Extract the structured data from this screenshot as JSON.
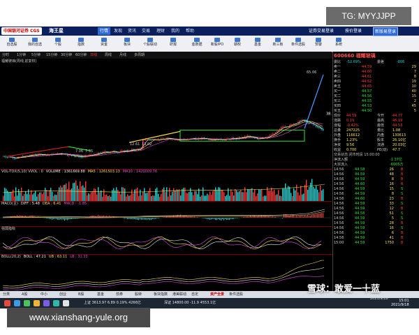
{
  "window": {
    "logo_text": "中国银河证券 CGS",
    "brand_name": "海王星"
  },
  "menu": [
    {
      "label": "行情",
      "active": true
    },
    {
      "label": "发现"
    },
    {
      "label": "资讯"
    },
    {
      "label": "交易"
    },
    {
      "label": "理财"
    },
    {
      "label": "我的"
    },
    {
      "label": "帮助"
    }
  ],
  "top_buttons": [
    "证券交易登录",
    "按价登录",
    "新版易登录"
  ],
  "toolbar": [
    {
      "label": "自选股",
      "icon": "star-icon"
    },
    {
      "label": "我的自选",
      "icon": "list-icon"
    },
    {
      "label": "个股",
      "icon": "chart-icon"
    },
    {
      "label": "指数",
      "icon": "index-icon"
    },
    {
      "label": "资金",
      "icon": "money-icon"
    },
    {
      "label": "板块",
      "icon": "grid-icon"
    },
    {
      "label": "个股联动",
      "icon": "link-icon"
    },
    {
      "label": "研报",
      "icon": "doc-icon"
    },
    {
      "label": "金数据",
      "icon": "data-icon"
    },
    {
      "label": "新股IPO",
      "icon": "ipo-icon"
    },
    {
      "label": "期权",
      "icon": "option-icon"
    },
    {
      "label": "基金",
      "icon": "fund-icon"
    },
    {
      "label": "新三板",
      "icon": "board-icon"
    },
    {
      "label": "条件选股",
      "icon": "filter-icon"
    },
    {
      "label": "预警",
      "icon": "bell-icon"
    },
    {
      "label": "系统",
      "icon": "gear-icon"
    }
  ],
  "periods": [
    "分时",
    "1分钟",
    "5分钟",
    "15分钟",
    "30分钟",
    "60分钟",
    "日线",
    "周线",
    "月线",
    "多周期"
  ],
  "chart_title": "福耀玻璃(周线,前复权)",
  "price_labels": {
    "hi": "65.06",
    "l1": "7.06",
    "l2": "7.55",
    "l3": "12.61",
    "l4": "13.02",
    "l5": "38.73"
  },
  "volume_title": [
    "VOL-TDX(5,10) VVOL : 0",
    "VOLUME : 1361669.88",
    "MA5 : 1261503.13",
    "MA10 : 1420009.76"
  ],
  "macd_title": [
    "MACD(主)",
    "DIFF : 5.48",
    "DEA : 6.41",
    "MACD : -1.85"
  ],
  "kdj_title": [
    "强弱指标"
  ],
  "boll_title": [
    "BOLL(20,2)",
    "BOLL : 47.21",
    "UB : 63.11",
    "LB : 31.33"
  ],
  "quote": {
    "code": "600660 福耀玻璃",
    "ratio_label": "委比",
    "ratio_value": "-52.69%",
    "diff_label": "委差",
    "diff_value": "-806",
    "sell": [
      {
        "label": "卖五",
        "price": "44.65",
        "vol": "10"
      },
      {
        "label": "卖四",
        "price": "44.62",
        "vol": "19"
      },
      {
        "label": "卖三",
        "price": "44.61",
        "vol": "8"
      },
      {
        "label": "卖二",
        "price": "44.60",
        "vol": "7"
      },
      {
        "label": "卖一",
        "price": "44.59",
        "vol": "29"
      }
    ],
    "buy": [
      {
        "label": "买一",
        "price": "44.57",
        "vol": "40"
      },
      {
        "label": "买二",
        "price": "44.56",
        "vol": "15"
      },
      {
        "label": "买三",
        "price": "44.55",
        "vol": "2"
      },
      {
        "label": "买四",
        "price": "44.53",
        "vol": "45"
      },
      {
        "label": "买五",
        "price": "44.50",
        "vol": "5"
      }
    ],
    "stats": [
      {
        "k": "现价",
        "v": "44.59",
        "k2": "今开",
        "v2": "44.77"
      },
      {
        "k": "涨跌",
        "v": "0.19",
        "k2": "最高",
        "v2": "45.19"
      },
      {
        "k": "涨幅",
        "v": "-0.42%",
        "k2": "最低",
        "v2": "44.53"
      },
      {
        "k": "总量",
        "v": "247225",
        "k2": "量比",
        "v2": "1.08"
      },
      {
        "k": "外盘",
        "v": "116612",
        "k2": "内盘",
        "v2": "130613"
      },
      {
        "k": "换手",
        "v": "1.23%",
        "k2": "股本",
        "v2": "26.10亿"
      },
      {
        "k": "净资",
        "v": "9.56",
        "k2": "流通",
        "v2": "20.03亿"
      },
      {
        "k": "收益",
        "v": "0.700",
        "k2": "PE(动)",
        "v2": "47.7"
      }
    ],
    "status": "交易状态:闭市时段 15:00:00",
    "flows": [
      {
        "k": "净流入额",
        "v": "-1.37亿"
      },
      {
        "k": "大宗流入",
        "v": "-6005万"
      }
    ],
    "ticks": [
      {
        "t": "14:56",
        "p": "44.58",
        "v": "26",
        "d": "B"
      },
      {
        "t": "14:56",
        "p": "44.59",
        "v": "48",
        "d": "B"
      },
      {
        "t": "14:56",
        "p": "44.59",
        "v": "8",
        "d": "B"
      },
      {
        "t": "14:56",
        "p": "44.60",
        "v": "16",
        "d": "B"
      },
      {
        "t": "14:56",
        "p": "44.59",
        "v": "15",
        "d": "S"
      },
      {
        "t": "14:56",
        "p": "44.59",
        "v": "8",
        "d": "S"
      },
      {
        "t": "14:56",
        "p": "44.60",
        "v": "23",
        "d": "B"
      },
      {
        "t": "14:56",
        "p": "44.59",
        "v": "33",
        "d": "S"
      },
      {
        "t": "14:56",
        "p": "44.59",
        "v": "12",
        "d": "B"
      },
      {
        "t": "14:56",
        "p": "44.58",
        "v": "51",
        "d": "S"
      },
      {
        "t": "14:56",
        "p": "44.59",
        "v": "5",
        "d": "S"
      },
      {
        "t": "14:56",
        "p": "44.59",
        "v": "28",
        "d": "B"
      },
      {
        "t": "14:56",
        "p": "44.59",
        "v": "16",
        "d": "S"
      },
      {
        "t": "14:56",
        "p": "44.59",
        "v": "6",
        "d": "B"
      },
      {
        "t": "14:56",
        "p": "44.59",
        "v": "41",
        "d": "B"
      },
      {
        "t": "15:00",
        "p": "44.59",
        "v": "1750",
        "d": "B"
      }
    ]
  },
  "bottom_tabs": [
    {
      "label": "分类"
    },
    {
      "label": "A股"
    },
    {
      "label": "中小"
    },
    {
      "label": "创业"
    },
    {
      "label": "B股"
    },
    {
      "label": "基金"
    },
    {
      "label": "债券"
    },
    {
      "label": "股转"
    },
    {
      "label": "板块指数"
    },
    {
      "label": "港美联动"
    },
    {
      "label": "自定"
    },
    {
      "label": "资产全景",
      "active": true
    },
    {
      "label": "条件选股"
    }
  ],
  "taskbar": {
    "ticker": "上证 3613.97  6.89  0.19%  4266亿",
    "extra": "深证 14800.00  -11.9  4553.1亿",
    "time": "15:01",
    "date": "2021/9/18"
  },
  "overlay": {
    "tg_badge": "TG: MYYJJPP",
    "xq_text": "雪球：敢爱一十蓝",
    "xq_date": "2021/9/18",
    "watermark": "www.xianshang-yule.org"
  },
  "colors": {
    "up": "#ff3b3b",
    "down": "#19d4d4",
    "green": "#2ee62e",
    "yellow": "#ffe14a",
    "white": "#f0f0f0",
    "magenta": "#e050e0"
  }
}
